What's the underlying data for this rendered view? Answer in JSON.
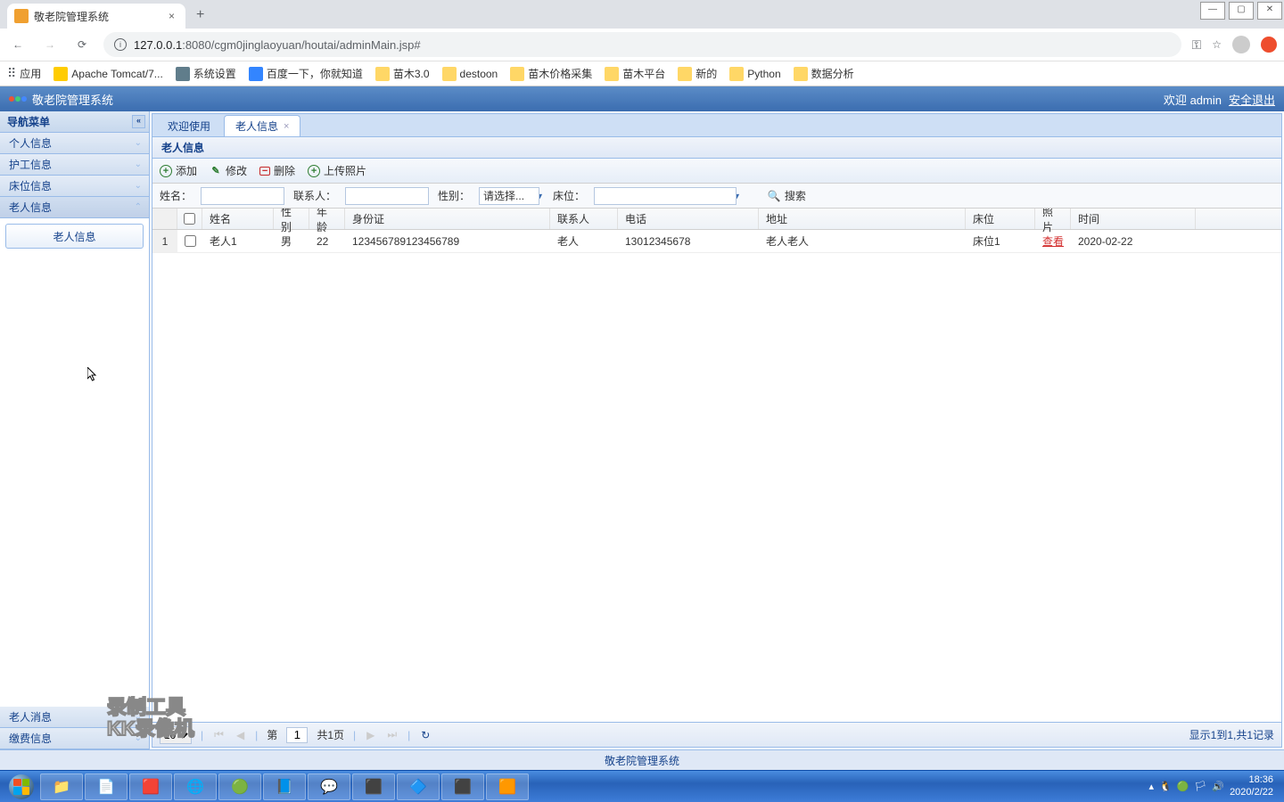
{
  "browser": {
    "tab_title": "敬老院管理系统",
    "url_host": "127.0.0.1",
    "url_port": ":8080",
    "url_path": "/cgm0jinglaoyuan/houtai/adminMain.jsp#",
    "apps_label": "应用",
    "bookmarks": [
      {
        "label": "Apache Tomcat/7...",
        "icon": "tomcat"
      },
      {
        "label": "系统设置",
        "icon": "gear"
      },
      {
        "label": "百度一下，你就知道",
        "icon": "paw"
      },
      {
        "label": "苗木3.0",
        "icon": "folder"
      },
      {
        "label": "destoon",
        "icon": "folder"
      },
      {
        "label": "苗木价格采集",
        "icon": "folder"
      },
      {
        "label": "苗木平台",
        "icon": "folder"
      },
      {
        "label": "新的",
        "icon": "folder"
      },
      {
        "label": "Python",
        "icon": "folder"
      },
      {
        "label": "数据分析",
        "icon": "folder"
      }
    ]
  },
  "app": {
    "title": "敬老院管理系统",
    "welcome_prefix": "欢迎",
    "welcome_user": "admin",
    "logout": "安全退出",
    "footer": "敬老院管理系统"
  },
  "sidebar": {
    "title": "导航菜单",
    "items": [
      {
        "label": "个人信息"
      },
      {
        "label": "护工信息"
      },
      {
        "label": "床位信息"
      },
      {
        "label": "老人信息"
      },
      {
        "label": "老人消息"
      },
      {
        "label": "缴费信息"
      }
    ],
    "sub_item": "老人信息"
  },
  "tabs": {
    "welcome": "欢迎使用",
    "elder_info": "老人信息"
  },
  "panel": {
    "title": "老人信息",
    "toolbar": {
      "add": "添加",
      "edit": "修改",
      "delete": "删除",
      "upload": "上传照片"
    },
    "search": {
      "name_label": "姓名：",
      "contact_label": "联系人：",
      "gender_label": "性别：",
      "gender_placeholder": "请选择...",
      "bed_label": "床位：",
      "search_btn": "搜索"
    },
    "cols": {
      "name": "姓名",
      "gender": "性别",
      "age": "年龄",
      "id": "身份证",
      "contact": "联系人",
      "phone": "电话",
      "addr": "地址",
      "bed": "床位",
      "photo": "照片",
      "time": "时间"
    },
    "rows": [
      {
        "num": "1",
        "name": "老人1",
        "gender": "男",
        "age": "22",
        "id": "123456789123456789",
        "contact": "老人",
        "phone": "13012345678",
        "addr": "老人老人",
        "bed": "床位1",
        "photo": "查看",
        "time": "2020-02-22"
      }
    ],
    "paging": {
      "page_size": "10",
      "page_label_prefix": "第",
      "page_current": "1",
      "total_pages": "共1页",
      "display_info": "显示1到1,共1记录"
    }
  },
  "taskbar": {
    "time": "18:36",
    "date": "2020/2/22"
  }
}
